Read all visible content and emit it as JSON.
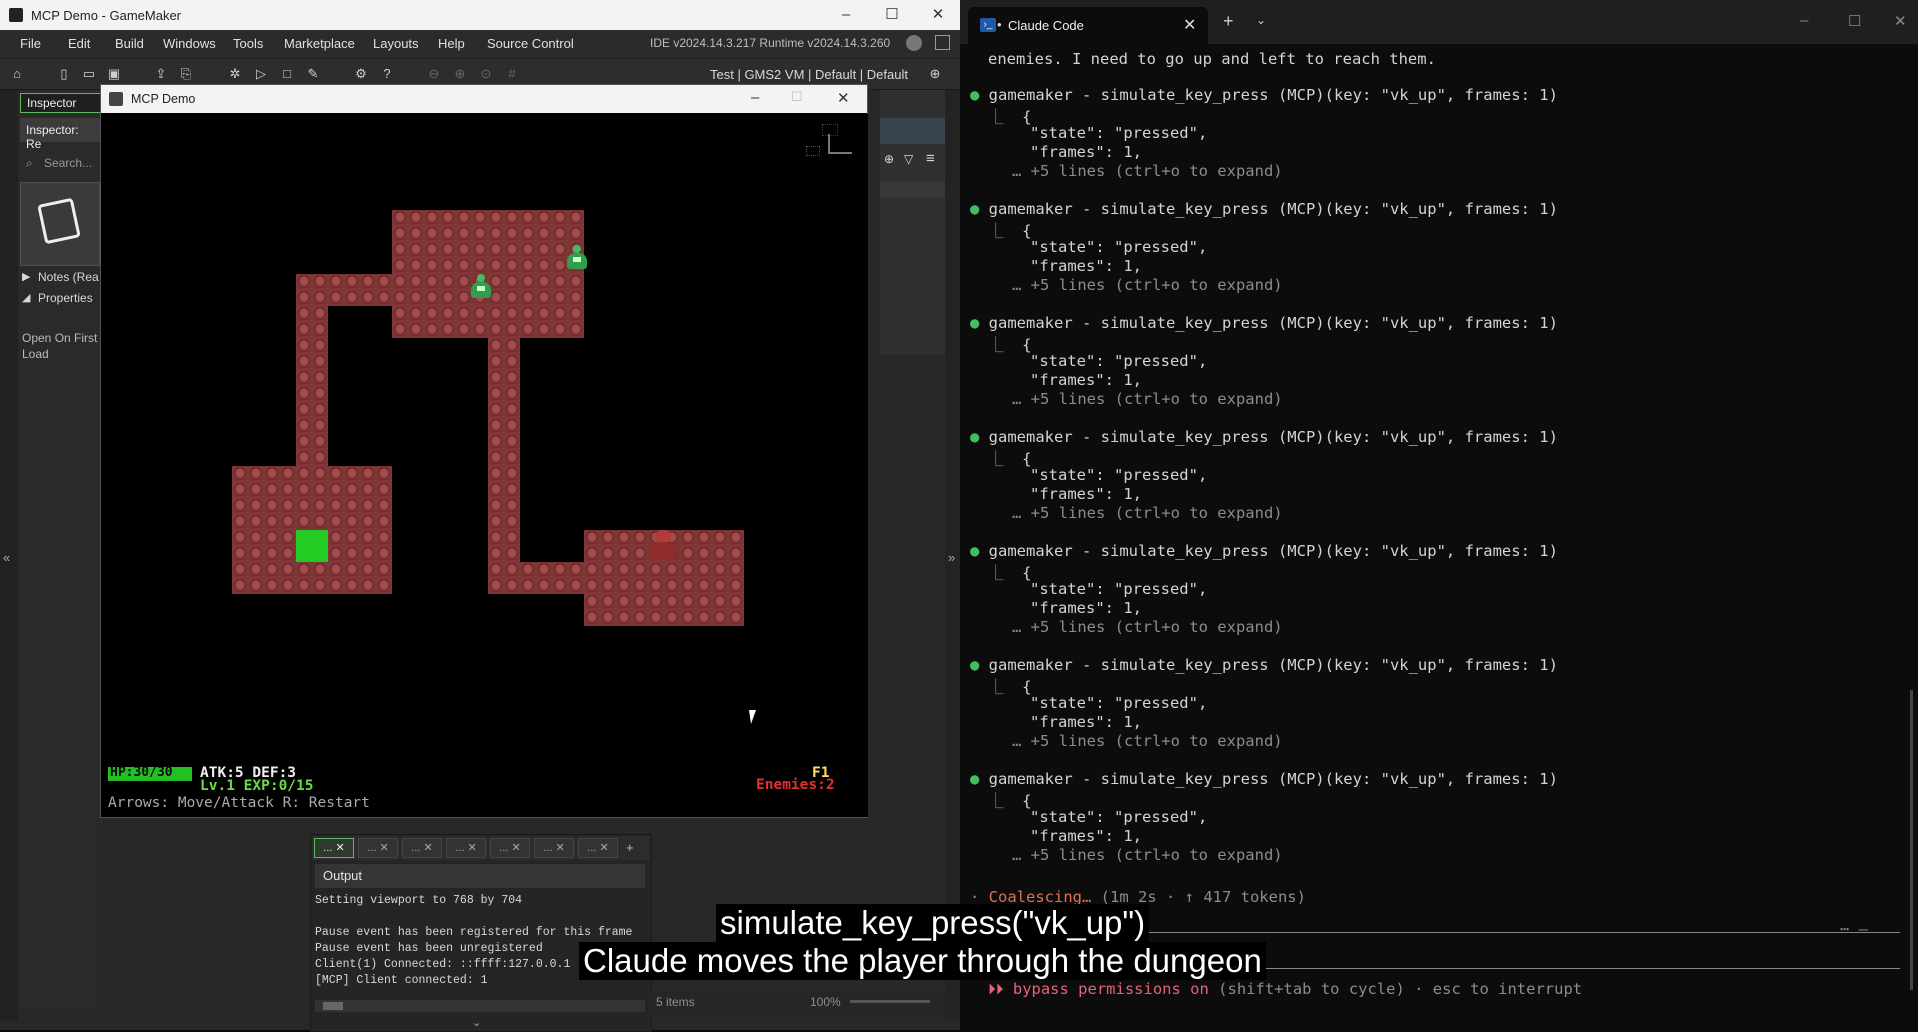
{
  "gm": {
    "title": "MCP Demo - GameMaker",
    "menu": [
      "File",
      "Edit",
      "Build",
      "Windows",
      "Tools",
      "Marketplace",
      "Layouts",
      "Help",
      "Source Control"
    ],
    "version": "IDE v2024.14.3.217  Runtime v2024.14.3.260",
    "toolbar_config": "Test | GMS2 VM | Default | Default",
    "left": {
      "tab": "Inspector",
      "subheader": "Inspector: Re",
      "search_placeholder": "Search...",
      "notes": "Notes (Rea",
      "properties": "Properties",
      "open_on_first_load": "Open On First Load"
    },
    "output": {
      "header": "Output",
      "lines": [
        "Setting viewport to 768 by 704",
        "",
        "Pause event has been registered for this frame",
        "Pause event has been unregistered",
        "Client(1) Connected: ::ffff:127.0.0.1",
        "[MCP] Client connected: 1"
      ],
      "tab_label": "..."
    },
    "status_items": "5 items",
    "zoom": "100%"
  },
  "game": {
    "title": "MCP Demo",
    "hp": "HP:30/30",
    "hp_fraction": 1.0,
    "stats": "ATK:5 DEF:3",
    "level": "Lv.1 EXP:0/15",
    "controls": "Arrows: Move/Attack  R: Restart",
    "floor": "F1",
    "enemies": "Enemies:2",
    "colors": {
      "floor": "#7e3535",
      "stairs": "#22cc22",
      "enemy": "#3fbf5f",
      "player": "#b23a3a",
      "hp": "#22c022",
      "level": "#66dd44",
      "enemies_text": "#e23030"
    }
  },
  "terminal": {
    "tab_title": "Claude Code",
    "intro": "enemies. I need to go up and left to reach them.",
    "calls": [
      {
        "call": "gamemaker - simulate_key_press (MCP)(key: \"vk_up\", frames: 1)",
        "brace": "{",
        "state": "\"state\": \"pressed\",",
        "frames": "\"frames\": 1,",
        "more": "… +5 lines (ctrl+o to expand)"
      },
      {
        "call": "gamemaker - simulate_key_press (MCP)(key: \"vk_up\", frames: 1)",
        "brace": "{",
        "state": "\"state\": \"pressed\",",
        "frames": "\"frames\": 1,",
        "more": "… +5 lines (ctrl+o to expand)"
      },
      {
        "call": "gamemaker - simulate_key_press (MCP)(key: \"vk_up\", frames: 1)",
        "brace": "{",
        "state": "\"state\": \"pressed\",",
        "frames": "\"frames\": 1,",
        "more": "… +5 lines (ctrl+o to expand)"
      },
      {
        "call": "gamemaker - simulate_key_press (MCP)(key: \"vk_up\", frames: 1)",
        "brace": "{",
        "state": "\"state\": \"pressed\",",
        "frames": "\"frames\": 1,",
        "more": "… +5 lines (ctrl+o to expand)"
      },
      {
        "call": "gamemaker - simulate_key_press (MCP)(key: \"vk_up\", frames: 1)",
        "brace": "{",
        "state": "\"state\": \"pressed\",",
        "frames": "\"frames\": 1,",
        "more": "… +5 lines (ctrl+o to expand)"
      },
      {
        "call": "gamemaker - simulate_key_press (MCP)(key: \"vk_up\", frames: 1)",
        "brace": "{",
        "state": "\"state\": \"pressed\",",
        "frames": "\"frames\": 1,",
        "more": "… +5 lines (ctrl+o to expand)"
      },
      {
        "call": "gamemaker - simulate_key_press (MCP)(key: \"vk_up\", frames: 1)",
        "brace": "{",
        "state": "\"state\": \"pressed\",",
        "frames": "\"frames\": 1,",
        "more": "… +5 lines (ctrl+o to expand)"
      }
    ],
    "status_word": "Coalescing…",
    "status_detail": "(1m 2s · ↑ 417 tokens)",
    "permissions_arrow": "⏵⏵",
    "permissions_on": "bypass permissions on",
    "permissions_rest": "(shift+tab to cycle) · esc to interrupt"
  },
  "captions": {
    "line1": "simulate_key_press(\"vk_up\")",
    "line2": "Claude moves the player through the dungeon"
  }
}
